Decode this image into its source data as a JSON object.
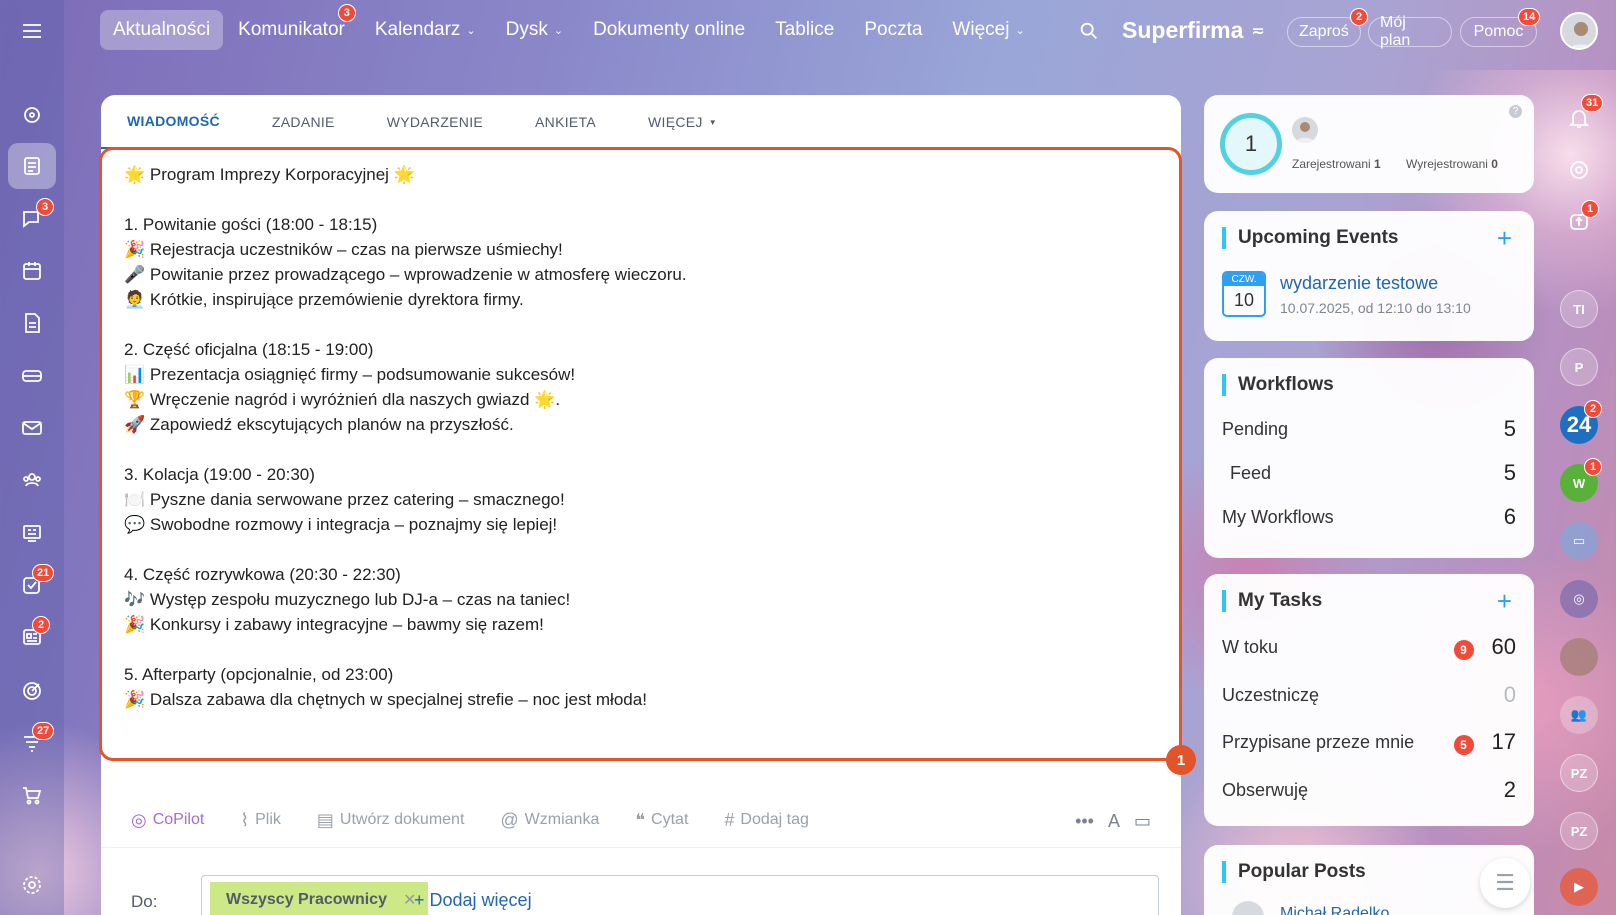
{
  "nav": {
    "items": [
      {
        "label": "Aktualności",
        "caret": false,
        "badge": ""
      },
      {
        "label": "Komunikator",
        "caret": false,
        "badge": "3"
      },
      {
        "label": "Kalendarz",
        "caret": true,
        "badge": ""
      },
      {
        "label": "Dysk",
        "caret": true,
        "badge": ""
      },
      {
        "label": "Dokumenty online",
        "caret": false,
        "badge": ""
      },
      {
        "label": "Tablice",
        "caret": false,
        "badge": ""
      },
      {
        "label": "Poczta",
        "caret": false,
        "badge": ""
      },
      {
        "label": "Więcej",
        "caret": true,
        "badge": ""
      }
    ],
    "brand": "Superfirma",
    "invite": "Zaproś",
    "invite_badge": "2",
    "plan": "Mój plan",
    "help": "Pomoc",
    "help_badge": "14"
  },
  "rail_badges": {
    "chat": "3",
    "tasks": "21",
    "feed": "2",
    "funnel": "27"
  },
  "composer": {
    "tabs": [
      "WIADOMOŚĆ",
      "ZADANIE",
      "WYDARZENIE",
      "ANKIETA",
      "WIĘCEJ"
    ],
    "lines": [
      "🌟 Program Imprezy Korporacyjnej 🌟",
      "",
      "1. Powitanie gości (18:00 - 18:15)",
      "🎉 Rejestracja uczestników – czas na pierwsze uśmiechy!",
      "🎤 Powitanie przez prowadzącego – wprowadzenie w atmosferę wieczoru.",
      "🧑‍💼 Krótkie, inspirujące przemówienie dyrektora firmy.",
      "",
      "2. Część oficjalna (18:15 - 19:00)",
      "📊 Prezentacja osiągnięć firmy – podsumowanie sukcesów!",
      "🏆 Wręczenie nagród i wyróżnień dla naszych gwiazd 🌟.",
      "🚀 Zapowiedź ekscytujących planów na przyszłość.",
      "",
      "3. Kolacja (19:00 - 20:30)",
      "🍽️ Pyszne dania serwowane przez catering – smacznego!",
      "💬 Swobodne rozmowy i integracja – poznajmy się lepiej!",
      "",
      "4. Część rozrywkowa (20:30 - 22:30)",
      "🎶 Występ zespołu muzycznego lub DJ-a – czas na taniec!",
      "🎉 Konkursy i zabawy integracyjne – bawmy się razem!",
      "",
      "5. Afterparty (opcjonalnie, od 23:00)",
      "🎉 Dalsza zabawa dla chętnych w specjalnej strefie – noc jest młoda!"
    ],
    "step": "1",
    "toolbar": [
      "CoPilot",
      "Plik",
      "Utwórz dokument",
      "Wzmianka",
      "Cytat",
      "Dodaj tag"
    ],
    "to_label": "Do:",
    "recipient": "Wszyscy Pracownicy",
    "add_more": "Dodaj więcej"
  },
  "attendance": {
    "count": "1",
    "registered_label": "Zarejestrowani",
    "registered": "1",
    "unregistered_label": "Wyrejestrowani",
    "unregistered": "0"
  },
  "events": {
    "title": "Upcoming Events",
    "day_name": "CZW.",
    "day": "10",
    "name": "wydarzenie testowe",
    "when": "10.07.2025, od 12:10 do 13:10"
  },
  "workflows": {
    "title": "Workflows",
    "rows": [
      {
        "label": "Pending",
        "value": "5"
      },
      {
        "label": "Feed",
        "value": "5"
      },
      {
        "label": "My Workflows",
        "value": "6"
      }
    ]
  },
  "tasks": {
    "title": "My Tasks",
    "rows": [
      {
        "label": "W toku",
        "badge": "9",
        "value": "60"
      },
      {
        "label": "Uczestniczę",
        "badge": "",
        "value": "0"
      },
      {
        "label": "Przypisane przeze mnie",
        "badge": "5",
        "value": "17"
      },
      {
        "label": "Obserwuję",
        "badge": "",
        "value": "2"
      }
    ]
  },
  "popular": {
    "title": "Popular Posts",
    "author": "Michał Radelko"
  },
  "right_rail": {
    "bell_badge": "31",
    "sync_badge": "1",
    "b24_badge": "2",
    "w_badge": "1",
    "avatars": [
      "TI",
      "P",
      "PZ",
      "PZ"
    ],
    "b24": "24",
    "w": "W"
  }
}
